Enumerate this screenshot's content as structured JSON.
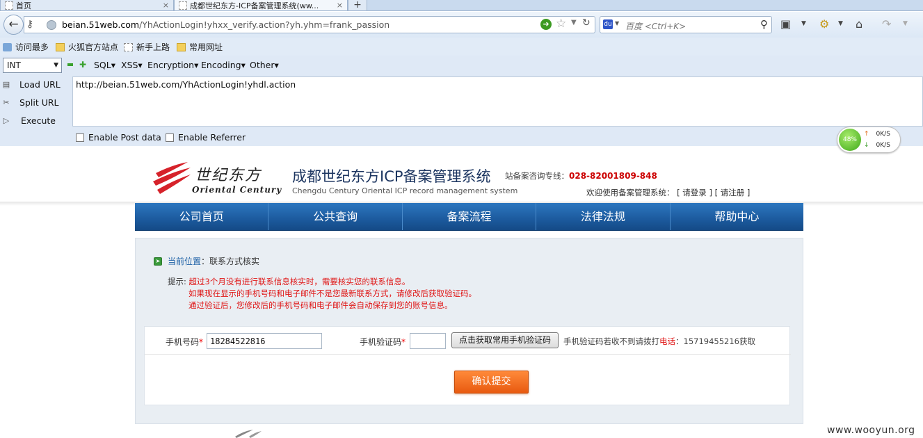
{
  "browser": {
    "tabs": [
      {
        "label": "首页",
        "close": "×"
      },
      {
        "label": "成都世纪东方-ICP备案管理系统(ww...",
        "close": "×"
      }
    ],
    "new_tab": "+",
    "url_host": "beian.51web.com",
    "url_path": "/YhActionLogin!yhxx_verify.action?yh.yhm=frank_passion",
    "search_placeholder": "百度 <Ctrl+K>",
    "search_engine_label": "du"
  },
  "bookmarks": [
    {
      "label": "访问最多",
      "icon": "star-list-icon"
    },
    {
      "label": "火狐官方站点",
      "icon": "folder-icon"
    },
    {
      "label": "新手上路",
      "icon": "page-icon"
    },
    {
      "label": "常用网址",
      "icon": "folder-icon"
    }
  ],
  "hackbar": {
    "select_value": "INT",
    "menus": [
      "SQL▾",
      "XSS▾",
      "Encryption▾",
      "Encoding▾",
      "Other▾"
    ],
    "load_url": "Load URL",
    "split_url": "Split URL",
    "execute": "Execute",
    "url_value": "http://beian.51web.com/YhActionLogin!yhdl.action",
    "enable_post": "Enable Post data",
    "enable_referrer": "Enable Referrer"
  },
  "traffic": {
    "percent": "48%",
    "up": "0K/S",
    "down": "0K/S"
  },
  "site": {
    "brand_cn": "世纪东方",
    "brand_en": "Oriental Century",
    "title": "成都世纪东方ICP备案管理系统",
    "subtitle": "Chengdu Century Oriental ICP record management system",
    "hotline_label": "站备案咨询专线：",
    "hotline_number": "028-82001809-848",
    "welcome": "欢迎使用备案管理系统：",
    "login": "[ 请登录 ]",
    "register": "[ 请注册 ]",
    "nav": [
      "公司首页",
      "公共查询",
      "备案流程",
      "法律法规",
      "帮助中心"
    ]
  },
  "page": {
    "crumb_label": "当前位置",
    "crumb_value": "：联系方式核实",
    "tip_label": "提示:",
    "tips": [
      "超过3个月没有进行联系信息核实时，需要核实您的联系信息。",
      "如果现在显示的手机号码和电子邮件不是您最新联系方式，请修改后获取验证码。",
      "通过验证后，您修改后的手机号码和电子邮件会自动保存到您的账号信息。"
    ],
    "phone_label": "手机号码",
    "phone_value": "18284522816",
    "code_label": "手机验证码",
    "code_value": "",
    "get_code_button": "点击获取常用手机验证码",
    "note_prefix": "手机验证码若收不到请拨打",
    "note_tel_word": "电话",
    "note_suffix": "：15719455216获取",
    "submit": "确认提交"
  },
  "watermark": "www.wooyun.org",
  "colors": {
    "nav_blue": "#1c5a9e",
    "tip_red": "#e01515",
    "submit_orange": "#e85a10",
    "hotline_red": "#cc0000"
  }
}
